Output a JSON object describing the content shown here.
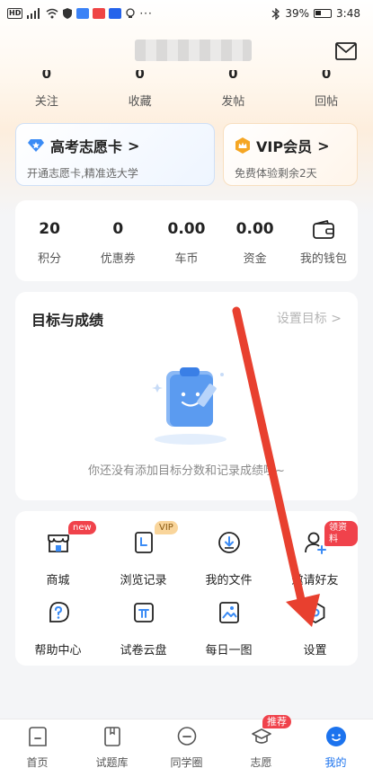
{
  "status_bar": {
    "battery": "39%",
    "time": "3:48"
  },
  "stats": [
    {
      "value": "0",
      "label": "关注"
    },
    {
      "value": "0",
      "label": "收藏"
    },
    {
      "value": "0",
      "label": "发帖"
    },
    {
      "value": "0",
      "label": "回帖"
    }
  ],
  "promo": {
    "gaokao": {
      "title": "高考志愿卡",
      "chevron": ">",
      "subtitle": "开通志愿卡,精准选大学"
    },
    "vip": {
      "title": "VIP会员",
      "chevron": ">",
      "subtitle": "免费体验剩余2天"
    }
  },
  "wallet": [
    {
      "value": "20",
      "label": "积分"
    },
    {
      "value": "0",
      "label": "优惠券"
    },
    {
      "value": "0.00",
      "label": "车币"
    },
    {
      "value": "0.00",
      "label": "资金"
    },
    {
      "label": "我的钱包"
    }
  ],
  "goals": {
    "title": "目标与成绩",
    "link": "设置目标 >",
    "empty_text": "你还没有添加目标分数和记录成绩哦~"
  },
  "tools": [
    {
      "label": "商城",
      "badge": "new"
    },
    {
      "label": "浏览记录",
      "badge": "VIP"
    },
    {
      "label": "我的文件"
    },
    {
      "label": "邀请好友",
      "badge": "领资料"
    },
    {
      "label": "帮助中心"
    },
    {
      "label": "试卷云盘"
    },
    {
      "label": "每日一图"
    },
    {
      "label": "设置"
    }
  ],
  "nav": [
    {
      "label": "首页"
    },
    {
      "label": "试题库"
    },
    {
      "label": "同学圈"
    },
    {
      "label": "志愿",
      "badge": "推荐"
    },
    {
      "label": "我的"
    }
  ],
  "colors": {
    "accent": "#1c73ee",
    "badge_red": "#f0424b",
    "vip_orange": "#f5a623",
    "annotation_red": "#e8402f"
  }
}
